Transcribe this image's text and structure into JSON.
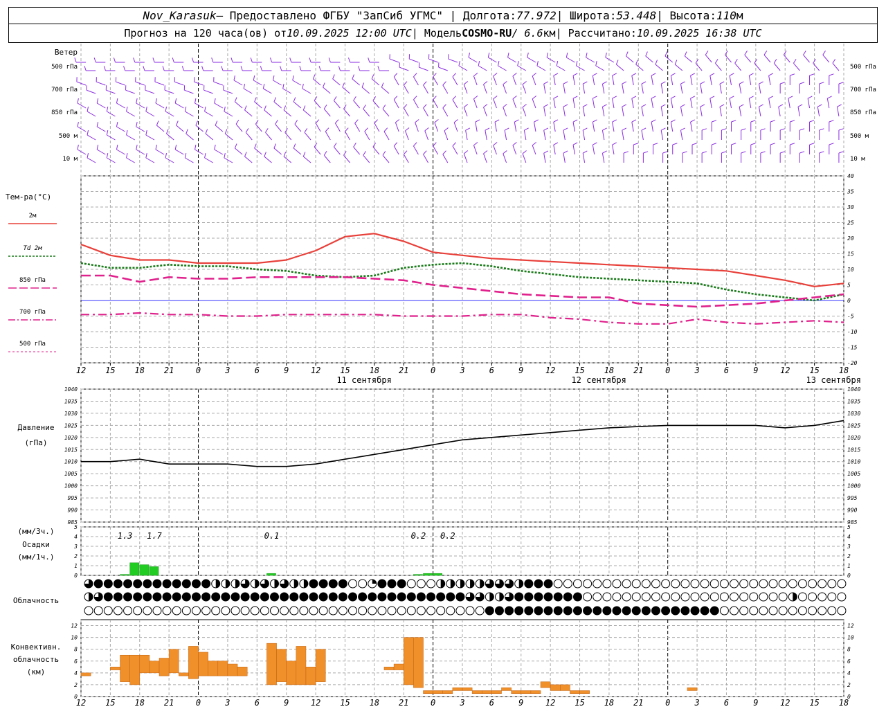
{
  "header": {
    "line1": {
      "station": "Nov_Karasuk",
      "provided": " – Предоставлено ФГБУ \"ЗапСиб УГМС\" | Долгота: ",
      "lon": "77.972",
      "lat_label": " | Широта: ",
      "lat": "53.448",
      "alt_label": " | Высота: ",
      "alt": "110",
      "alt_unit": "м"
    },
    "line2": {
      "forecast": "Прогноз на 120 часа(ов) от ",
      "from": "10.09.2025 12:00 UTC",
      "model_label": "  | Модель ",
      "model": "COSMO-RU",
      "res": " / 6.6",
      "res_unit": "км",
      "calc_label": " | Рассчитано: ",
      "calc": "10.09.2025 16:38 UTC"
    }
  },
  "labels": {
    "wind": "Ветер",
    "wind_levels": [
      "500 гПа",
      "700 гПа",
      "850 гПа",
      "500 м",
      "10  м"
    ],
    "temp_title": "Тем-ра(°С)",
    "legend": [
      "2м",
      "Td  2м",
      "850 гПа",
      "700 гПа",
      "500 гПа"
    ],
    "pressure_title": "Давление",
    "pressure_unit": "(гПа)",
    "precip_unit3": "(мм/3ч.)",
    "precip_title": "Осадки",
    "precip_unit1": "(мм/1ч.)",
    "cloud_title": "Облачность",
    "conv_title": [
      "Конвективн.",
      "облачность",
      "(км)"
    ],
    "date_labels": [
      {
        "h": 24,
        "t": "11 сентября"
      },
      {
        "h": 48,
        "t": "12 сентября"
      },
      {
        "h": 72,
        "t": "13 сентября"
      }
    ]
  },
  "colors": {
    "t2m": "#e8403a",
    "td2m": "#1a7a1a",
    "t850": "#e0208c",
    "t700": "#e0208c",
    "t500": "#e0208c",
    "wind": "#8a2be2",
    "precip": "#22cc22",
    "conv": "#f0902a",
    "zero": "#3030ff"
  },
  "chart_data": {
    "type": "line",
    "x_hours_ticks": [
      "12",
      "15",
      "18",
      "21",
      "0",
      "3",
      "6",
      "9",
      "12",
      "15",
      "18",
      "21",
      "0",
      "3",
      "6",
      "9",
      "12",
      "15",
      "18",
      "21",
      "0",
      "3",
      "6",
      "9",
      "12",
      "15",
      "18"
    ],
    "x_range_hours": [
      0,
      78
    ],
    "temperature": {
      "ylim": [
        -20,
        40
      ],
      "yticks": [
        -20,
        -15,
        -10,
        -5,
        0,
        5,
        10,
        15,
        20,
        25,
        30,
        35,
        40
      ],
      "series": [
        {
          "name": "2м",
          "x": [
            0,
            3,
            6,
            9,
            12,
            15,
            18,
            21,
            24,
            27,
            30,
            33,
            36,
            39,
            42,
            45,
            48,
            51,
            54,
            57,
            60,
            63,
            66,
            69,
            72,
            75,
            78
          ],
          "values": [
            18,
            14.5,
            13,
            13,
            12,
            12,
            12,
            13,
            16,
            20.5,
            21.5,
            19,
            15.5,
            14.5,
            13.5,
            13,
            12.5,
            12,
            11.5,
            11,
            10.5,
            10,
            9.5,
            8,
            6.5,
            4.5,
            5.5
          ]
        },
        {
          "name": "Td 2м",
          "x": [
            0,
            3,
            6,
            9,
            12,
            15,
            18,
            21,
            24,
            27,
            30,
            33,
            36,
            39,
            42,
            45,
            48,
            51,
            54,
            57,
            60,
            63,
            66,
            69,
            72,
            75,
            78
          ],
          "values": [
            12,
            10.5,
            10.5,
            11.5,
            11,
            11,
            10,
            9.5,
            8,
            7.5,
            8,
            10.5,
            11.5,
            12,
            11,
            9.5,
            8.5,
            7.5,
            7,
            6.5,
            6,
            5.5,
            3.5,
            2,
            1,
            0,
            2
          ]
        },
        {
          "name": "850 гПа",
          "x": [
            0,
            3,
            6,
            9,
            12,
            15,
            18,
            21,
            24,
            27,
            30,
            33,
            36,
            39,
            42,
            45,
            48,
            51,
            54,
            57,
            60,
            63,
            66,
            69,
            72,
            75,
            78
          ],
          "values": [
            8,
            8,
            6,
            7.5,
            7,
            7,
            7.5,
            7.5,
            7.5,
            7.5,
            7,
            6.5,
            5,
            4,
            3,
            2,
            1.5,
            1,
            1,
            -1,
            -1.5,
            -2,
            -1.5,
            -1,
            0,
            1,
            2
          ]
        },
        {
          "name": "700 гПа",
          "x": [
            0,
            3,
            6,
            9,
            12,
            15,
            18,
            21,
            24,
            27,
            30,
            33,
            36,
            39,
            42,
            45,
            48,
            51,
            54,
            57,
            60,
            63,
            66,
            69,
            72,
            75,
            78
          ],
          "values": [
            -4.5,
            -4.5,
            -4,
            -4.5,
            -4.5,
            -5,
            -5,
            -4.5,
            -4.5,
            -4.5,
            -4.5,
            -5,
            -5,
            -5,
            -4.5,
            -4.5,
            -5.5,
            -6,
            -7,
            -7.5,
            -7.5,
            -6,
            -7,
            -7.5,
            -7,
            -6.5,
            -7
          ]
        }
      ]
    },
    "pressure": {
      "ylim": [
        985,
        1040
      ],
      "yticks": [
        985,
        990,
        995,
        1000,
        1005,
        1010,
        1015,
        1020,
        1025,
        1030,
        1035,
        1040
      ],
      "x": [
        0,
        3,
        6,
        9,
        12,
        15,
        18,
        21,
        24,
        27,
        30,
        33,
        36,
        39,
        42,
        45,
        48,
        51,
        54,
        57,
        60,
        63,
        66,
        69,
        72,
        75,
        78
      ],
      "values": [
        1010,
        1010,
        1011,
        1009,
        1009,
        1009,
        1008,
        1008,
        1009,
        1011,
        1013,
        1015,
        1017,
        1019,
        1020,
        1021,
        1022,
        1023,
        1024,
        1024.5,
        1025,
        1025,
        1025,
        1025,
        1024,
        1025,
        1027
      ]
    },
    "precipitation": {
      "ylim": [
        0,
        5
      ],
      "yticks": [
        0,
        1,
        2,
        3,
        4,
        5
      ],
      "hourly": [
        {
          "h": 4,
          "v": 0.1
        },
        {
          "h": 5,
          "v": 1.3
        },
        {
          "h": 6,
          "v": 1.1
        },
        {
          "h": 7,
          "v": 0.9
        },
        {
          "h": 19,
          "v": 0.2
        },
        {
          "h": 34,
          "v": 0.1
        },
        {
          "h": 35,
          "v": 0.2
        },
        {
          "h": 36,
          "v": 0.2
        }
      ],
      "three_hour_labels": [
        {
          "h": 4.5,
          "t": "1.3"
        },
        {
          "h": 7.5,
          "t": "1.7"
        },
        {
          "h": 19.5,
          "t": "0.1"
        },
        {
          "h": 34.5,
          "t": "0.2"
        },
        {
          "h": 37.5,
          "t": "0.2"
        }
      ]
    },
    "cloudiness": {
      "rows": [
        "3444444444444222323232244440014440002222233324440000000000000000000000000000000",
        "2344444444444444444444444444444444444443322344444440000000000000000000002000000000",
        "00000000000000000000000000000000000000000444444444444444444444444000000000000000"
      ]
    },
    "convective": {
      "ylim": [
        0,
        13
      ],
      "yticks": [
        0,
        2,
        4,
        6,
        8,
        10,
        12
      ],
      "bars": [
        {
          "h": 0.5,
          "b": 3.5,
          "t": 4
        },
        {
          "h": 3.5,
          "b": 4.5,
          "t": 5
        },
        {
          "h": 4.5,
          "b": 2.5,
          "t": 7
        },
        {
          "h": 5.5,
          "b": 2,
          "t": 7
        },
        {
          "h": 6.5,
          "b": 4,
          "t": 7
        },
        {
          "h": 7.5,
          "b": 4,
          "t": 6
        },
        {
          "h": 8.5,
          "b": 3.5,
          "t": 6.5
        },
        {
          "h": 9.5,
          "b": 4,
          "t": 8
        },
        {
          "h": 10.5,
          "b": 3.5,
          "t": 4
        },
        {
          "h": 11.5,
          "b": 3,
          "t": 8.5
        },
        {
          "h": 12.5,
          "b": 3.5,
          "t": 7.5
        },
        {
          "h": 13.5,
          "b": 3.5,
          "t": 6
        },
        {
          "h": 14.5,
          "b": 3.5,
          "t": 6
        },
        {
          "h": 15.5,
          "b": 3.5,
          "t": 5.5
        },
        {
          "h": 16.5,
          "b": 3.5,
          "t": 5
        },
        {
          "h": 19.5,
          "b": 2,
          "t": 9
        },
        {
          "h": 20.5,
          "b": 2.5,
          "t": 8
        },
        {
          "h": 21.5,
          "b": 2,
          "t": 6
        },
        {
          "h": 22.5,
          "b": 2,
          "t": 8.5
        },
        {
          "h": 23.5,
          "b": 2,
          "t": 5
        },
        {
          "h": 24.5,
          "b": 2.5,
          "t": 8
        },
        {
          "h": 31.5,
          "b": 4.5,
          "t": 5
        },
        {
          "h": 32.5,
          "b": 4.5,
          "t": 5.5
        },
        {
          "h": 33.5,
          "b": 2,
          "t": 10
        },
        {
          "h": 34.5,
          "b": 1.5,
          "t": 10
        },
        {
          "h": 35.5,
          "b": 0.5,
          "t": 1
        },
        {
          "h": 36.5,
          "b": 0.5,
          "t": 1
        },
        {
          "h": 37.5,
          "b": 0.5,
          "t": 1
        },
        {
          "h": 38.5,
          "b": 1,
          "t": 1.5
        },
        {
          "h": 39.5,
          "b": 1,
          "t": 1.5
        },
        {
          "h": 40.5,
          "b": 0.5,
          "t": 1
        },
        {
          "h": 41.5,
          "b": 0.5,
          "t": 1
        },
        {
          "h": 42.5,
          "b": 0.5,
          "t": 1
        },
        {
          "h": 43.5,
          "b": 1,
          "t": 1.5
        },
        {
          "h": 44.5,
          "b": 0.5,
          "t": 1
        },
        {
          "h": 45.5,
          "b": 0.5,
          "t": 1
        },
        {
          "h": 46.5,
          "b": 0.5,
          "t": 1
        },
        {
          "h": 47.5,
          "b": 1.5,
          "t": 2.5
        },
        {
          "h": 48.5,
          "b": 1,
          "t": 2
        },
        {
          "h": 49.5,
          "b": 1,
          "t": 2
        },
        {
          "h": 50.5,
          "b": 0.5,
          "t": 1
        },
        {
          "h": 51.5,
          "b": 0.5,
          "t": 1
        },
        {
          "h": 62.5,
          "b": 1,
          "t": 1.5
        }
      ]
    },
    "wind": {
      "levels": [
        "500 гПа",
        "700 гПа",
        "850 гПа",
        "500 м",
        "10 м"
      ],
      "directions_deg": [
        [
          270,
          270,
          270,
          270,
          290,
          300,
          300,
          310,
          320,
          320
        ],
        [
          290,
          290,
          300,
          310,
          330,
          340,
          350,
          350,
          350,
          360
        ],
        [
          300,
          300,
          310,
          320,
          330,
          340,
          350,
          350,
          350,
          350
        ],
        [
          300,
          310,
          320,
          330,
          340,
          350,
          350,
          350,
          360,
          360
        ],
        [
          300,
          300,
          310,
          320,
          330,
          340,
          350,
          360,
          360,
          360
        ]
      ]
    }
  }
}
